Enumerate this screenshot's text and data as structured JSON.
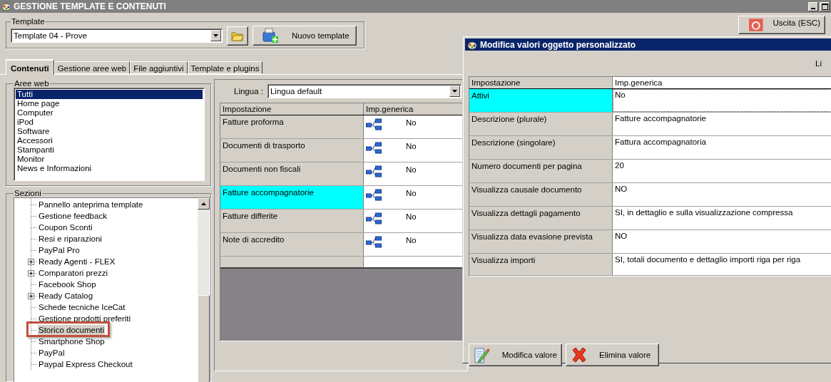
{
  "window": {
    "title": "GESTIONE TEMPLATE E CONTENUTI"
  },
  "template": {
    "label": "Template",
    "value": "Template 04 - Prove",
    "new_button": "Nuovo template"
  },
  "exit_button": "Uscita (ESC)",
  "tabs": [
    {
      "label": "Contenuti",
      "selected": true
    },
    {
      "label": "Gestione aree web",
      "selected": false
    },
    {
      "label": "File aggiuntivi",
      "selected": false
    },
    {
      "label": "Template e plugins",
      "selected": false
    }
  ],
  "web_areas": {
    "label": "Aree web",
    "items": [
      {
        "label": "Tutti",
        "selected": true
      },
      {
        "label": "Home page",
        "selected": false
      },
      {
        "label": "Computer",
        "selected": false
      },
      {
        "label": "iPod",
        "selected": false
      },
      {
        "label": "Software",
        "selected": false
      },
      {
        "label": "Accessori",
        "selected": false
      },
      {
        "label": "Stampanti",
        "selected": false
      },
      {
        "label": "Monitor",
        "selected": false
      },
      {
        "label": "News e Informazioni",
        "selected": false
      }
    ]
  },
  "sections": {
    "label": "Sezioni",
    "items": [
      {
        "label": "Pannello anteprima template",
        "kind": "leaf",
        "selected": false
      },
      {
        "label": "Gestione feedback",
        "kind": "leaf",
        "selected": false
      },
      {
        "label": "Coupon Sconti",
        "kind": "leaf",
        "selected": false
      },
      {
        "label": "Resi e riparazioni",
        "kind": "leaf",
        "selected": false
      },
      {
        "label": "PayPal Pro",
        "kind": "leaf",
        "selected": false
      },
      {
        "label": "Ready Agenti - FLEX",
        "kind": "group",
        "selected": false
      },
      {
        "label": "Comparatori prezzi",
        "kind": "group",
        "selected": false
      },
      {
        "label": "Facebook Shop",
        "kind": "leaf",
        "selected": false
      },
      {
        "label": "Ready Catalog",
        "kind": "group",
        "selected": false
      },
      {
        "label": "Schede tecniche IceCat",
        "kind": "leaf",
        "selected": false
      },
      {
        "label": "Gestione prodotti preferiti",
        "kind": "leaf",
        "selected": false
      },
      {
        "label": "Storico documenti",
        "kind": "leaf",
        "selected": true
      },
      {
        "label": "Smartphone Shop",
        "kind": "leaf",
        "selected": false
      },
      {
        "label": "PayPal",
        "kind": "leaf",
        "selected": false
      },
      {
        "label": "Paypal Express Checkout",
        "kind": "leaf",
        "selected": false
      }
    ]
  },
  "language": {
    "label": "Lingua :",
    "value": "Lingua default"
  },
  "table": {
    "columns": [
      "Impostazione",
      "Imp.generica"
    ],
    "rows": [
      {
        "name": "Fatture proforma",
        "value": "No",
        "selected": false
      },
      {
        "name": "Documenti di trasporto",
        "value": "No",
        "selected": false
      },
      {
        "name": "Documenti non fiscali",
        "value": "No",
        "selected": false
      },
      {
        "name": "Fatture accompagnatorie",
        "value": "No",
        "selected": true
      },
      {
        "name": "Fatture differite",
        "value": "No",
        "selected": false
      },
      {
        "name": "Note di accredito",
        "value": "No",
        "selected": false
      }
    ]
  },
  "dialog": {
    "title": "Modifica valori oggetto personalizzato",
    "language_label": "Li",
    "columns": [
      "Impostazione",
      "Imp.generica"
    ],
    "rows": [
      {
        "name": "Attivi",
        "value": "No",
        "selected": true
      },
      {
        "name": "Descrizione (plurale)",
        "value": "Fatture accompagnatorie",
        "selected": false
      },
      {
        "name": "Descrizione (singolare)",
        "value": "Fattura accompagnatoria",
        "selected": false
      },
      {
        "name": "Numero documenti per pagina",
        "value": "20",
        "selected": false
      },
      {
        "name": "Visualizza causale documento",
        "value": "NO",
        "selected": false
      },
      {
        "name": "Visualizza dettagli pagamento",
        "value": "SI, in dettaglio e sulla visualizzazione compressa",
        "selected": false
      },
      {
        "name": "Visualizza data evasione prevista",
        "value": "NO",
        "selected": false
      },
      {
        "name": "Visualizza importi",
        "value": "SI, totali documento e dettaglio importi riga per riga",
        "selected": false
      }
    ],
    "buttons": [
      {
        "label": "Modifica valore",
        "kind": "edit"
      },
      {
        "label": "Elimina valore",
        "kind": "delete"
      }
    ]
  }
}
